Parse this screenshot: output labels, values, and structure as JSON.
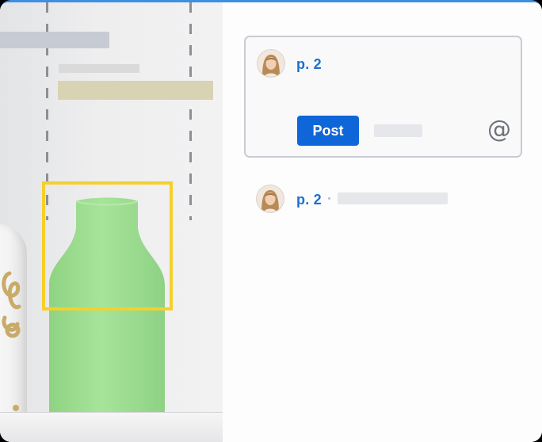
{
  "composer": {
    "page_label": "p. 2",
    "post_label": "Post",
    "mention_icon": "@"
  },
  "comment": {
    "page_label": "p. 2"
  },
  "icons": {
    "mention": "at-sign-icon",
    "avatar": "user-avatar"
  },
  "colors": {
    "accent": "#0f66d8",
    "selection": "#f5d02c",
    "vase": "#9fdf92",
    "frame": "#3d8fe6"
  }
}
